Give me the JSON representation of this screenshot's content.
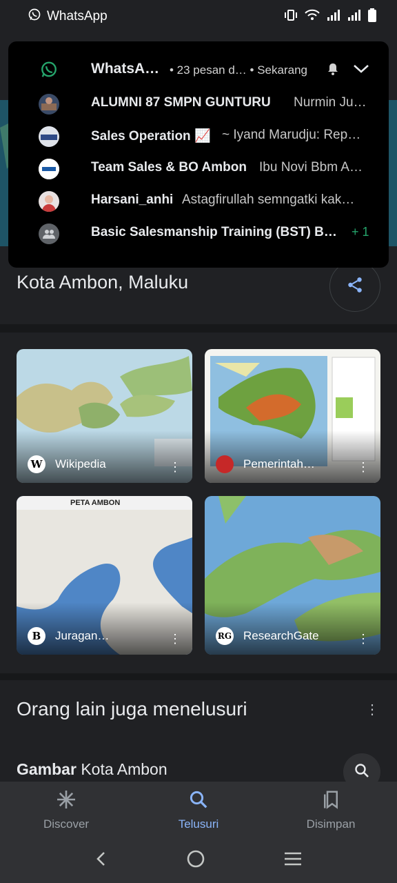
{
  "status_bar": {
    "app_name": "WhatsApp"
  },
  "notification": {
    "app": "WhatsA…",
    "meta": "• 23 pesan d… • Sekarang",
    "messages": [
      {
        "sender": "ALUMNI 87 SMPN GUNTURU",
        "preview": "Nurmin Ju…"
      },
      {
        "sender": "Sales Operation 📈",
        "preview": "~ Iyand Marudju: Rep…"
      },
      {
        "sender": "Team Sales & BO Ambon",
        "preview": "Ibu Novi Bbm A…"
      },
      {
        "sender": "Harsani_anhi",
        "preview": "Astagfirullah semngatki kak…"
      },
      {
        "sender": "Basic Salesmanship Training (BST) B…",
        "preview": ""
      }
    ],
    "extra_count": "+ 1"
  },
  "place": {
    "title": "Kota Ambon, Maluku"
  },
  "images": [
    {
      "source": "Wikipedia",
      "logo": "W"
    },
    {
      "source": "Pemerintah…",
      "logo": ""
    },
    {
      "source": "Juragan…",
      "logo": "B"
    },
    {
      "source": "ResearchGate",
      "logo": "RG"
    }
  ],
  "related": {
    "title": "Orang lain juga menelusuri",
    "item_bold": "Gambar",
    "item_rest": " Kota Ambon"
  },
  "bottom_nav": {
    "items": [
      {
        "label": "Discover",
        "icon": "asterisk-icon"
      },
      {
        "label": "Telusuri",
        "icon": "search-icon"
      },
      {
        "label": "Disimpan",
        "icon": "bookmarks-icon"
      }
    ],
    "active": "Telusuri"
  },
  "colors": {
    "accent": "#8ab4f8",
    "whatsapp_green": "#25a46b",
    "background": "#202124"
  }
}
